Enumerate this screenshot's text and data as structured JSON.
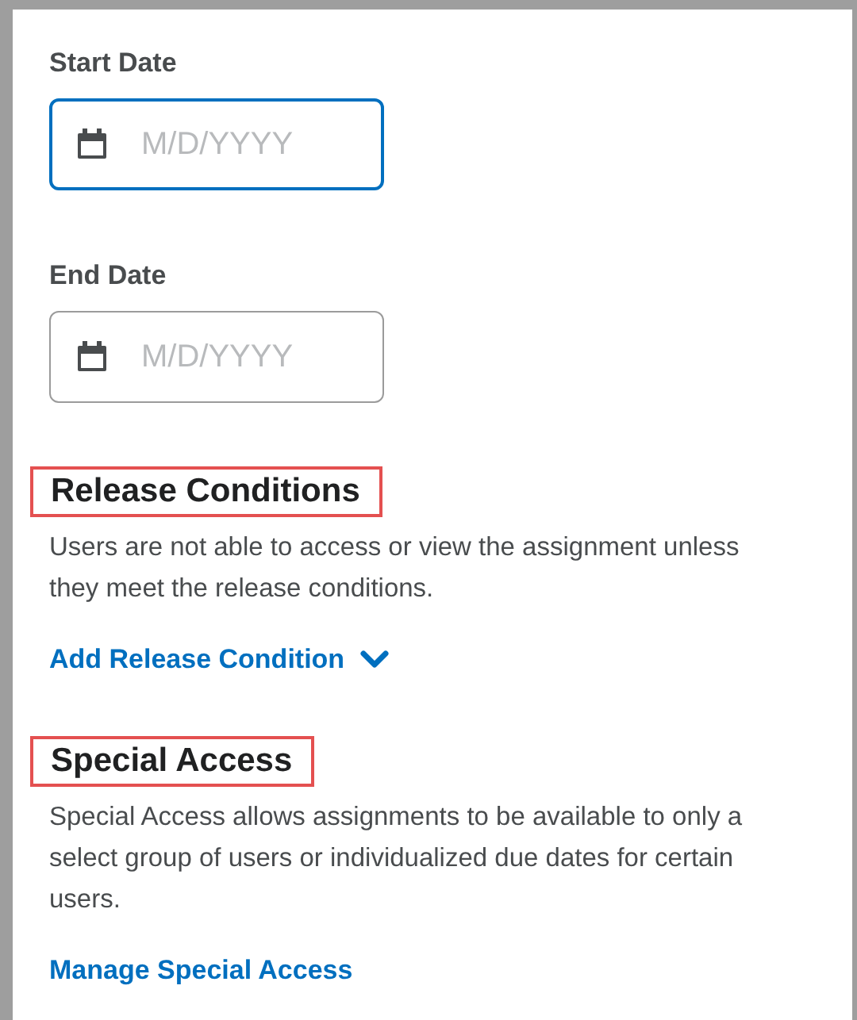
{
  "date_fields": [
    {
      "label": "Start Date",
      "placeholder": "M/D/YYYY",
      "focused": true
    },
    {
      "label": "End Date",
      "placeholder": "M/D/YYYY",
      "focused": false
    }
  ],
  "sections": [
    {
      "heading": "Release Conditions",
      "highlighted": true,
      "description": "Users are not able to access or view the assignment unless they meet the release conditions.",
      "link": "Add Release Condition",
      "dropdown": true
    },
    {
      "heading": "Special Access",
      "highlighted": true,
      "description": "Special Access allows assignments to be available to only a select group of users or individualized due dates for certain users.",
      "link": "Manage Special Access",
      "dropdown": false
    }
  ]
}
